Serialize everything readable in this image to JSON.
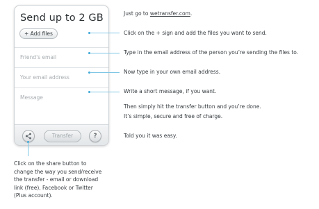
{
  "widget": {
    "title": "Send up to 2 GB",
    "add_files_label": "+ Add files",
    "friends_email_placeholder": "Friend's email",
    "your_email_placeholder": "Your email address",
    "message_placeholder": "Message",
    "transfer_label": "Transfer",
    "help_label": "?"
  },
  "instructions": {
    "intro_prefix": "Just go to ",
    "intro_link": "wetransfer.com",
    "intro_suffix": ".",
    "step_add": "Click on the + sign and add the files you want to send.",
    "step_friend": "Type in the email address of the person you’re sending the files to.",
    "step_own": "Now type in your own email address.",
    "step_message": "Write a short message, if you want.",
    "closing_1": "Then simply hit the transfer button and you’re done.",
    "closing_2": "It’s simple, secure and free of charge.",
    "told": "Told you it was easy."
  },
  "share_note": {
    "line1": "Click on the share button to",
    "line2": "change the way you send/receive",
    "line3": "the transfer - email or download",
    "line4": "link (free), Facebook or Twitter",
    "line5": "(Plus account)."
  },
  "colors": {
    "connector": "#7ec6e6",
    "connector_dot": "#3aa6d6"
  },
  "icons": {
    "share": "share-icon",
    "help": "question-mark-icon"
  }
}
